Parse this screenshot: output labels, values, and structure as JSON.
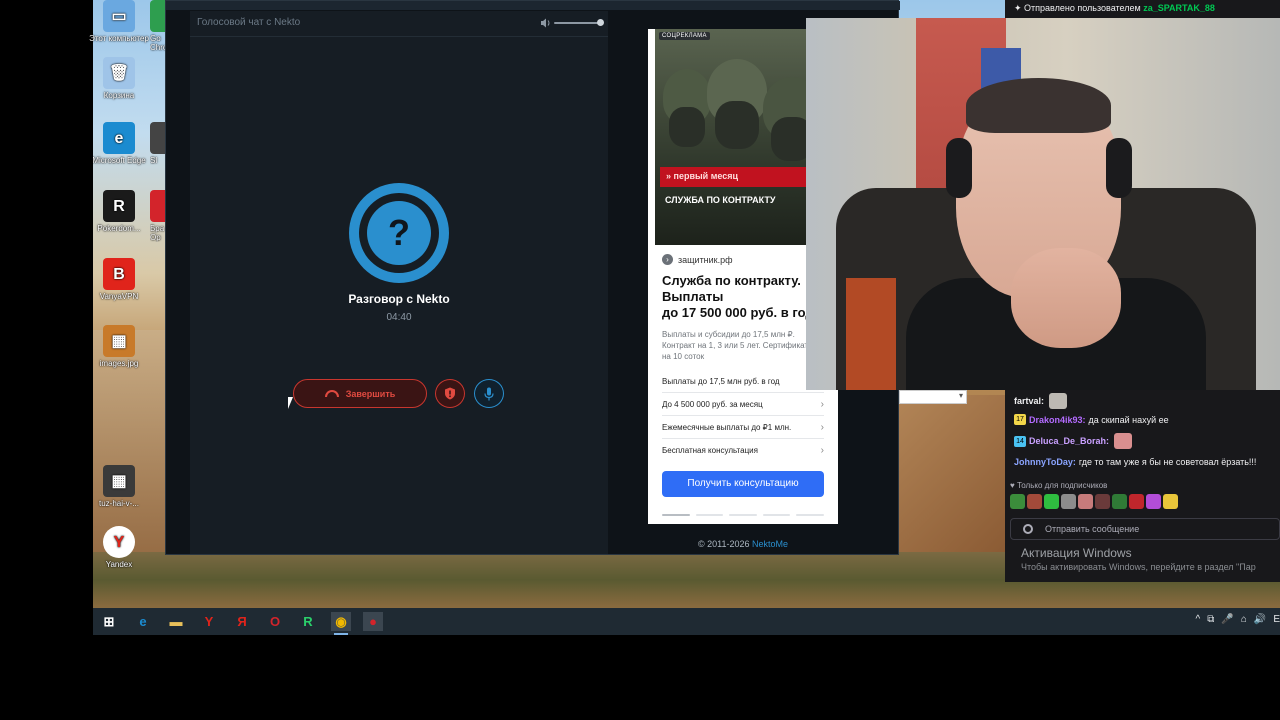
{
  "desktop": {
    "icons": [
      {
        "label": "Этот компьютер",
        "glyph": "▭",
        "color": "#6aa8e0"
      },
      {
        "label": "Корзина",
        "glyph": "🗑",
        "color": "#9fc4e8"
      },
      {
        "label": "Microsoft Edge",
        "glyph": "e",
        "color": "#1b8bd0"
      },
      {
        "label": "Pokerdom...",
        "glyph": "R",
        "color": "#1a1a1a"
      },
      {
        "label": "VanyaVPN",
        "glyph": "B",
        "color": "#e0241b"
      },
      {
        "label": "images.jpg",
        "glyph": "▦",
        "color": "#c87a2a"
      },
      {
        "label": "tuz-hai-v-...",
        "glyph": "▦",
        "color": "#3a3a3a"
      },
      {
        "label": "Yandex",
        "glyph": "Y",
        "color": "#ffffff"
      }
    ],
    "partial_icons": [
      {
        "label": "Go Chro",
        "color": "#2e9e4f"
      },
      {
        "label": "Sl",
        "color": "#444444"
      },
      {
        "label": "Бра Op",
        "color": "#d3242b"
      }
    ]
  },
  "voice_chat": {
    "title": "Голосовой чат с Nekto",
    "avatar_glyph": "?",
    "call_title": "Разговор с Nekto",
    "timer": "04:40",
    "end_label": "Завершить",
    "accent": "#2a8fce",
    "danger": "#c8362e"
  },
  "ad": {
    "badge": "СОЦРЕКЛАМА",
    "band_text": "» первый месяц",
    "image_text": "СЛУЖБА ПО КОНТРАКТУ",
    "domain": "защитник.рф",
    "title_lines": [
      "Служба по контракту.",
      "Выплаты",
      "до 17 500 000 руб. в год"
    ],
    "desc_lines": [
      "Выплаты и субсидии до 17,5 млн ₽.",
      "Контракт на 1, 3 или 5 лет. Сертификат",
      "на 10 соток"
    ],
    "links": [
      {
        "label": "Выплаты до 17,5 млн руб. в год",
        "chevron": ""
      },
      {
        "label": "До 4 500 000 руб. за месяц",
        "chevron": "›"
      },
      {
        "label": "Ежемесячные выплаты до ₽1 млн.",
        "chevron": "›"
      },
      {
        "label": "Бесплатная консультация",
        "chevron": "›"
      }
    ],
    "cta": "Получить консультацию"
  },
  "footer": {
    "copyright": "© 2011-2026",
    "brand_link": "NektoMe"
  },
  "stream_chat": {
    "pinned_prefix": "Отправлено пользователем",
    "pinned_user": "za_SPARTAK_88",
    "messages": [
      {
        "badge": "",
        "badge_color": "",
        "nick": "fartval:",
        "nick_color": "#efeff1",
        "text": "",
        "emote_color": "#bdb9b3"
      },
      {
        "badge": "17",
        "badge_color": "#f2d64a",
        "nick": "Drakon4ik93:",
        "nick_color": "#b36bff",
        "text": "да скипай нахуй ее",
        "emote_color": ""
      },
      {
        "badge": "14",
        "badge_color": "#4ac2f2",
        "nick": "Deluca_De_Borah:",
        "nick_color": "#c9a0ff",
        "text": "",
        "emote_color": "#d98f8f"
      },
      {
        "badge": "",
        "badge_color": "",
        "nick": "JohnnyToDay:",
        "nick_color": "#8aa4ff",
        "text": "где то там уже я бы не советовал ёрзать!!!",
        "emote_color": ""
      }
    ],
    "sub_only": "Только для подписчиков",
    "emote_colors": [
      "#3b8d3b",
      "#a34a3a",
      "#2fbd40",
      "#8c8c8c",
      "#c77b7b",
      "#6a3a3a",
      "#2f7a36",
      "#c0262c",
      "#b34dd8",
      "#e8c53a"
    ],
    "input_placeholder": "Отправить сообщение",
    "activation_title": "Активация Windows",
    "activation_sub": "Чтобы активировать Windows, перейдите в раздел \"Пар"
  },
  "taskbar": {
    "items": [
      {
        "name": "windows-start",
        "glyph": "⊞",
        "color": "#ffffff"
      },
      {
        "name": "edge",
        "glyph": "e",
        "color": "#1b8bd0"
      },
      {
        "name": "explorer",
        "glyph": "▬",
        "color": "#e8c05a"
      },
      {
        "name": "yandex-browser",
        "glyph": "Y",
        "color": "#e0241b"
      },
      {
        "name": "yandex",
        "glyph": "Я",
        "color": "#e0241b"
      },
      {
        "name": "opera",
        "glyph": "O",
        "color": "#d3242b"
      },
      {
        "name": "pokerdom",
        "glyph": "R",
        "color": "#2bd06b"
      },
      {
        "name": "chrome",
        "glyph": "◉",
        "color": "#f2b900"
      },
      {
        "name": "recorder",
        "glyph": "●",
        "color": "#d3242b"
      }
    ],
    "tray_glyphs": [
      "^",
      "⧉",
      "🎤",
      "⌂",
      "🔊",
      "E"
    ]
  }
}
